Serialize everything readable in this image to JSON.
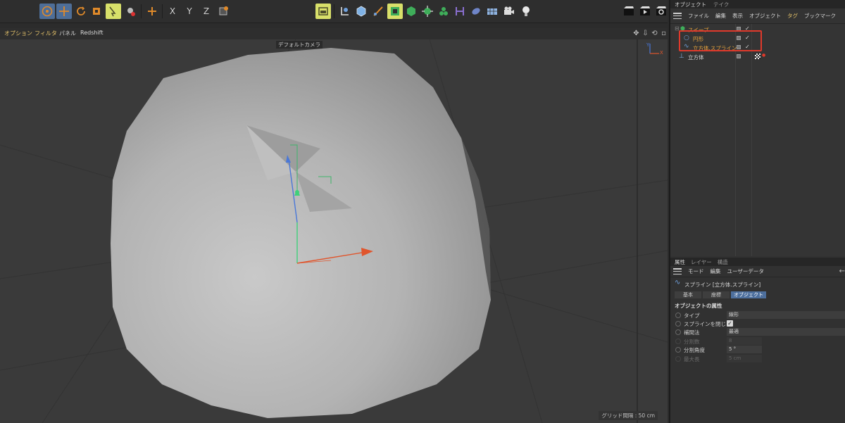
{
  "viewport": {
    "menu": [
      "オプション",
      "フィルタ",
      "パネル",
      "Redshift"
    ],
    "camera_label": "デフォルトカメラ",
    "grid_spacing": "グリッド間隔 : 50 cm",
    "axis_labels": {
      "y": "Y",
      "x": "X"
    }
  },
  "toolbar": {
    "axis_x": "X",
    "axis_y": "Y",
    "axis_z": "Z"
  },
  "object_manager": {
    "tabs": [
      "オブジェクト",
      "テイク"
    ],
    "menu": [
      "ファイル",
      "編集",
      "表示",
      "オブジェクト",
      "タグ",
      "ブックマーク"
    ],
    "objects": [
      {
        "name": "スイープ",
        "color": "#e6a23c"
      },
      {
        "name": "円形",
        "color": "#e6a23c"
      },
      {
        "name": "立方体.スプライン",
        "color": "#e6a23c"
      },
      {
        "name": "立方体",
        "color": "#d6d6d6"
      }
    ]
  },
  "attributes": {
    "tabs": [
      "属性",
      "レイヤー",
      "構造"
    ],
    "menu": [
      "モード",
      "編集",
      "ユーザーデータ"
    ],
    "title": "スプライン [立方体.スプライン]",
    "subtabs": [
      "基本",
      "座標",
      "オブジェクト"
    ],
    "section": "オブジェクトの属性",
    "props": [
      {
        "label": "タイプ",
        "value": "線形",
        "kind": "field"
      },
      {
        "label": "スプラインを閉じる",
        "value": "✓",
        "kind": "check"
      },
      {
        "label": "補間法",
        "value": "最適",
        "kind": "field"
      },
      {
        "label": "分割数",
        "value": "8",
        "kind": "dim"
      },
      {
        "label": "分割角度",
        "value": "5 °",
        "kind": "spin"
      },
      {
        "label": "最大長",
        "value": "5 cm",
        "kind": "dim"
      }
    ]
  },
  "colors": {
    "accent": "#4d6f9d",
    "selection_outline": "#e0392b",
    "orange_label": "#e6a23c"
  }
}
